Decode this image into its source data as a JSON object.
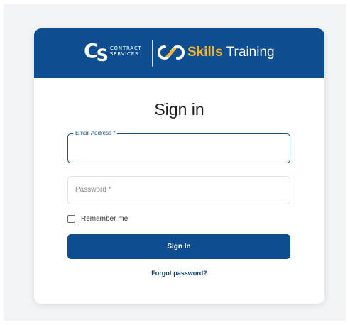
{
  "header": {
    "company_logo_text_line1": "CONTRACT",
    "company_logo_text_line2": "SERVICES",
    "company_logo_mark": "CS",
    "product_name_highlight": "Skills",
    "product_name_rest": "Training",
    "colors": {
      "header_bg": "#0f4d91",
      "highlight": "#f5b333"
    }
  },
  "form": {
    "title": "Sign in",
    "email_label": "Email Address *",
    "email_value": "",
    "password_placeholder": "Password *",
    "password_value": "",
    "remember_label": "Remember me",
    "remember_checked": false,
    "submit_label": "Sign In",
    "forgot_label": "Forgot password?"
  },
  "icons": {
    "product_icon": "skills-infinity-icon",
    "checkbox": "checkbox-icon"
  }
}
